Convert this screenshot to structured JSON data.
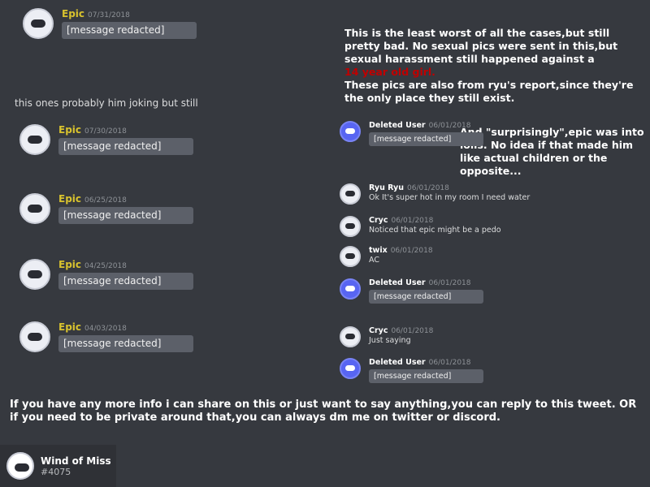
{
  "left_messages": [
    {
      "name": "Epic",
      "time": "07/31/2018",
      "text": "[message redacted]"
    },
    {
      "name": "Epic",
      "time": "07/30/2018",
      "text": "[message redacted]"
    },
    {
      "name": "Epic",
      "time": "06/25/2018",
      "text": "[message redacted]"
    },
    {
      "name": "Epic",
      "time": "04/25/2018",
      "text": "[message redacted]"
    },
    {
      "name": "Epic",
      "time": "04/03/2018",
      "text": "[message redacted]"
    }
  ],
  "caption_joking": "this ones probably him joking but still",
  "intro": "This is the least worst of all the cases,but still pretty bad. No sexual pics were sent in this,but sexual harassment still happened against a",
  "intro_red": "14 year old girl.",
  "intro2": "These pics are also from ryu's report,since they're the only place they still exist.",
  "loli_note": "And \"surprisingly\",epic was into lolis. No idea if that made him like actual children or the opposite...",
  "right_messages": [
    {
      "name": "Deleted User",
      "time": "06/01/2018",
      "text": "[message redacted]"
    },
    {
      "name": "Ryu Ryu",
      "time": "06/01/2018",
      "text": "Ok It's super hot in my room I need water"
    },
    {
      "name": "Cryc",
      "time": "06/01/2018",
      "text": "Noticed that epic might be a pedo"
    },
    {
      "name": "twix",
      "time": "06/01/2018",
      "text": "AC"
    },
    {
      "name": "Deleted User",
      "time": "06/01/2018",
      "text": "[message redacted]"
    },
    {
      "name": "Cryc",
      "time": "06/01/2018",
      "text": "Just saying"
    },
    {
      "name": "Deleted User",
      "time": "06/01/2018",
      "text": "[message redacted]"
    }
  ],
  "footer": "If you have any more info i can share on this or just want to say anything,you can reply to this tweet. OR if you need to be private around that,you can always dm me on twitter or discord.",
  "profile": {
    "name": "Wind of Miss",
    "tag": "#4075"
  }
}
